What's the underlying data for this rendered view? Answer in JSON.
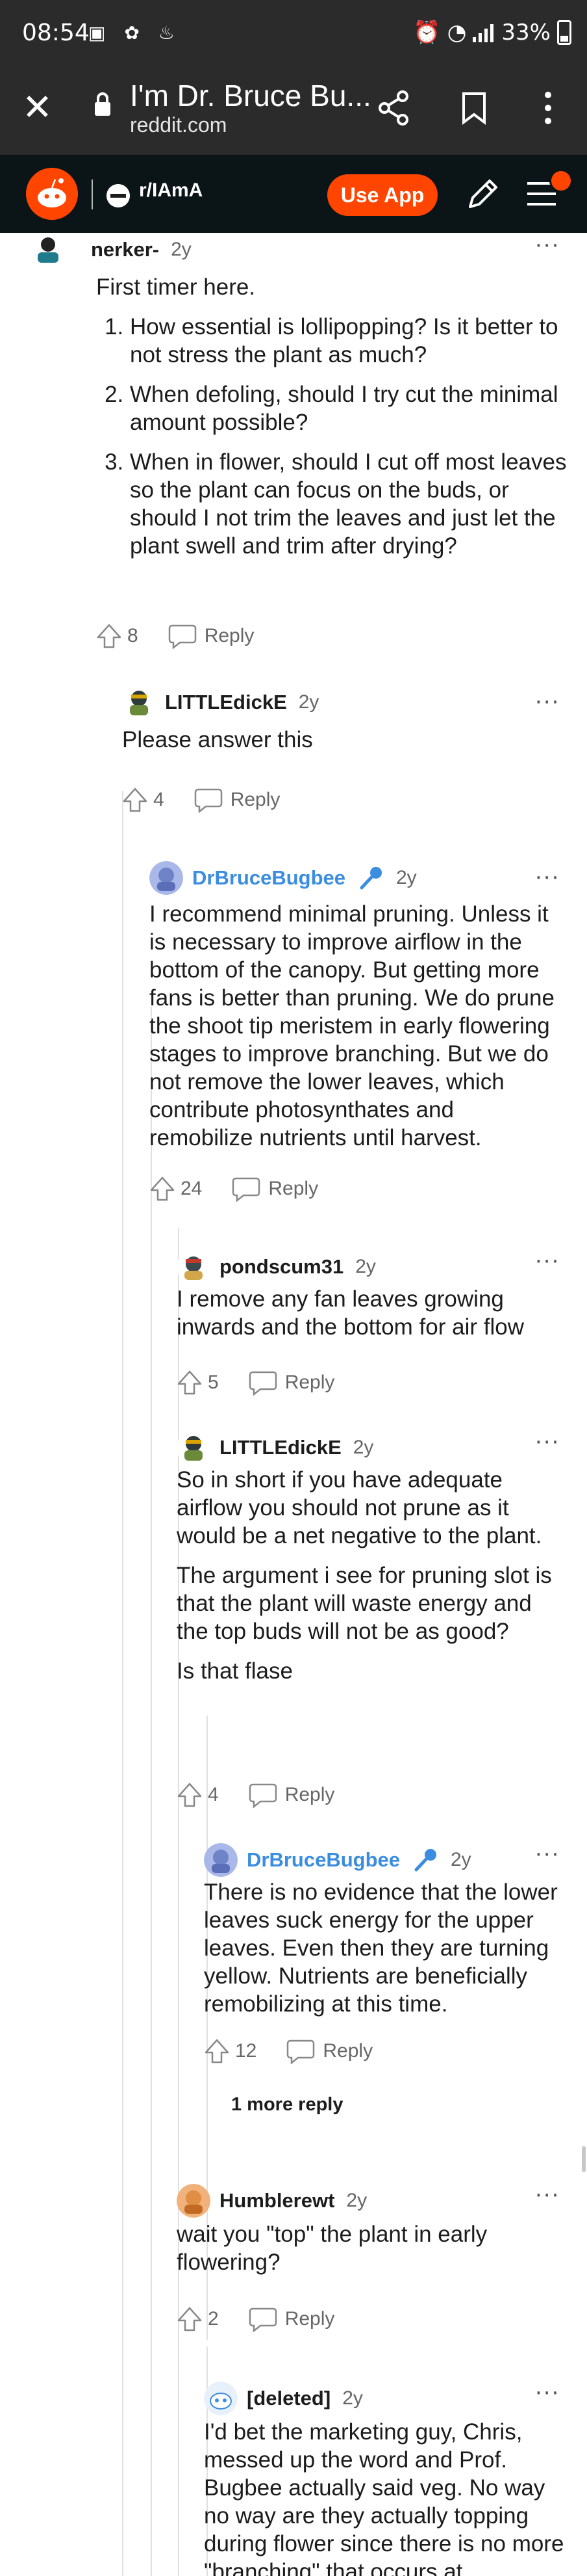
{
  "status_bar": {
    "time": "08:54",
    "battery": "33%"
  },
  "browser": {
    "tab_title": "I'm Dr. Bruce Bu...",
    "url": "reddit.com"
  },
  "reddit_header": {
    "subreddit": "r/IAmA",
    "use_app_label": "Use App"
  },
  "comments": [
    {
      "author": "nerker-",
      "age": "2y",
      "intro": "First timer here.",
      "list": [
        "How essential is lollipopping? Is it better to not stress the plant as much?",
        "When defoling, should I try cut the minimal amount possible?",
        "When in flower, should I cut off most leaves so the plant can focus on the buds, or should I not trim the leaves and just let the plant swell and trim after drying?"
      ],
      "votes": "8",
      "reply_label": "Reply"
    },
    {
      "author": "LITTLEdickE",
      "age": "2y",
      "paragraphs": [
        "Please answer this"
      ],
      "votes": "4",
      "reply_label": "Reply"
    },
    {
      "author": "DrBruceBugbee",
      "age": "2y",
      "paragraphs": [
        "I recommend minimal pruning. Unless it is necessary to improve airflow in the bottom of the canopy. But getting more fans is better than pruning. We do prune the shoot tip meristem in early flowering stages to improve branching. But we do not remove the lower leaves, which contribute photosynthates and remobilize nutrients until harvest."
      ],
      "votes": "24",
      "reply_label": "Reply"
    },
    {
      "author": "pondscum31",
      "age": "2y",
      "paragraphs": [
        "I remove any fan leaves growing inwards and the bottom for air flow"
      ],
      "votes": "5",
      "reply_label": "Reply"
    },
    {
      "author": "LITTLEdickE",
      "age": "2y",
      "paragraphs": [
        "So in short if you have adequate airflow you should not prune as it would be a net negative to the plant.",
        "The argument i see for pruning slot is that the plant will waste energy and the top buds will not be as good?",
        "Is that flase"
      ],
      "votes": "4",
      "reply_label": "Reply"
    },
    {
      "author": "DrBruceBugbee",
      "age": "2y",
      "paragraphs": [
        "There is no evidence that the lower leaves suck energy for the upper leaves. Even then they are turning yellow. Nutrients are beneficially remobilizing at this time."
      ],
      "votes": "12",
      "reply_label": "Reply",
      "more_replies": "1 more reply"
    },
    {
      "author": "Humblerewt",
      "age": "2y",
      "paragraphs": [
        "wait you \"top\" the plant in early flowering?"
      ],
      "votes": "2",
      "reply_label": "Reply"
    },
    {
      "author": "[deleted]",
      "age": "2y",
      "paragraphs": [
        "I'd bet the marketing guy, Chris, messed up the word and Prof. Bugbee actually said veg. No way no way are they actually topping during flower since there is no more \"branching\" that occurs at"
      ]
    }
  ],
  "colors": {
    "reddit_orange": "#ff4500",
    "op_blue": "#3a8de0",
    "chrome_dark": "#2b2b2b"
  }
}
